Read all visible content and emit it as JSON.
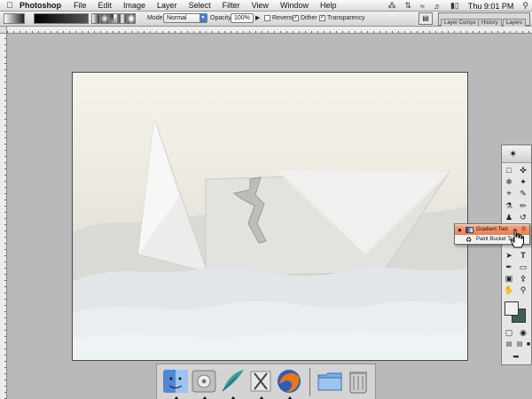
{
  "menubar": {
    "apple": "",
    "app_name": "Photoshop",
    "items": [
      "File",
      "Edit",
      "Image",
      "Layer",
      "Select",
      "Filter",
      "View",
      "Window",
      "Help"
    ],
    "clock": "Thu 9:01 PM"
  },
  "options_bar": {
    "mode_label": "Mode:",
    "mode_value": "Normal",
    "opacity_label": "Opacity:",
    "opacity_value": "100%",
    "reverse_label": "Reverse",
    "reverse_checked": false,
    "dither_label": "Dither",
    "dither_checked": true,
    "transparency_label": "Transparency",
    "transparency_checked": true,
    "palette_tabs": [
      "Layer Comps",
      "History",
      "Layers"
    ]
  },
  "tool_flyout": {
    "items": [
      {
        "label": "Gradient Tool",
        "shortcut": "G",
        "selected": true
      },
      {
        "label": "Paint Bucket Tool",
        "shortcut": "",
        "selected": false
      }
    ]
  },
  "colors": {
    "foreground": "#f0f0f0",
    "background": "#3f5f5a",
    "flyout_highlight": "#ea7d52"
  },
  "dock": {
    "items": [
      "finder-icon",
      "system-preferences-icon",
      "mail-icon",
      "preview-icon",
      "firefox-icon",
      "folder-icon",
      "trash-icon"
    ]
  }
}
